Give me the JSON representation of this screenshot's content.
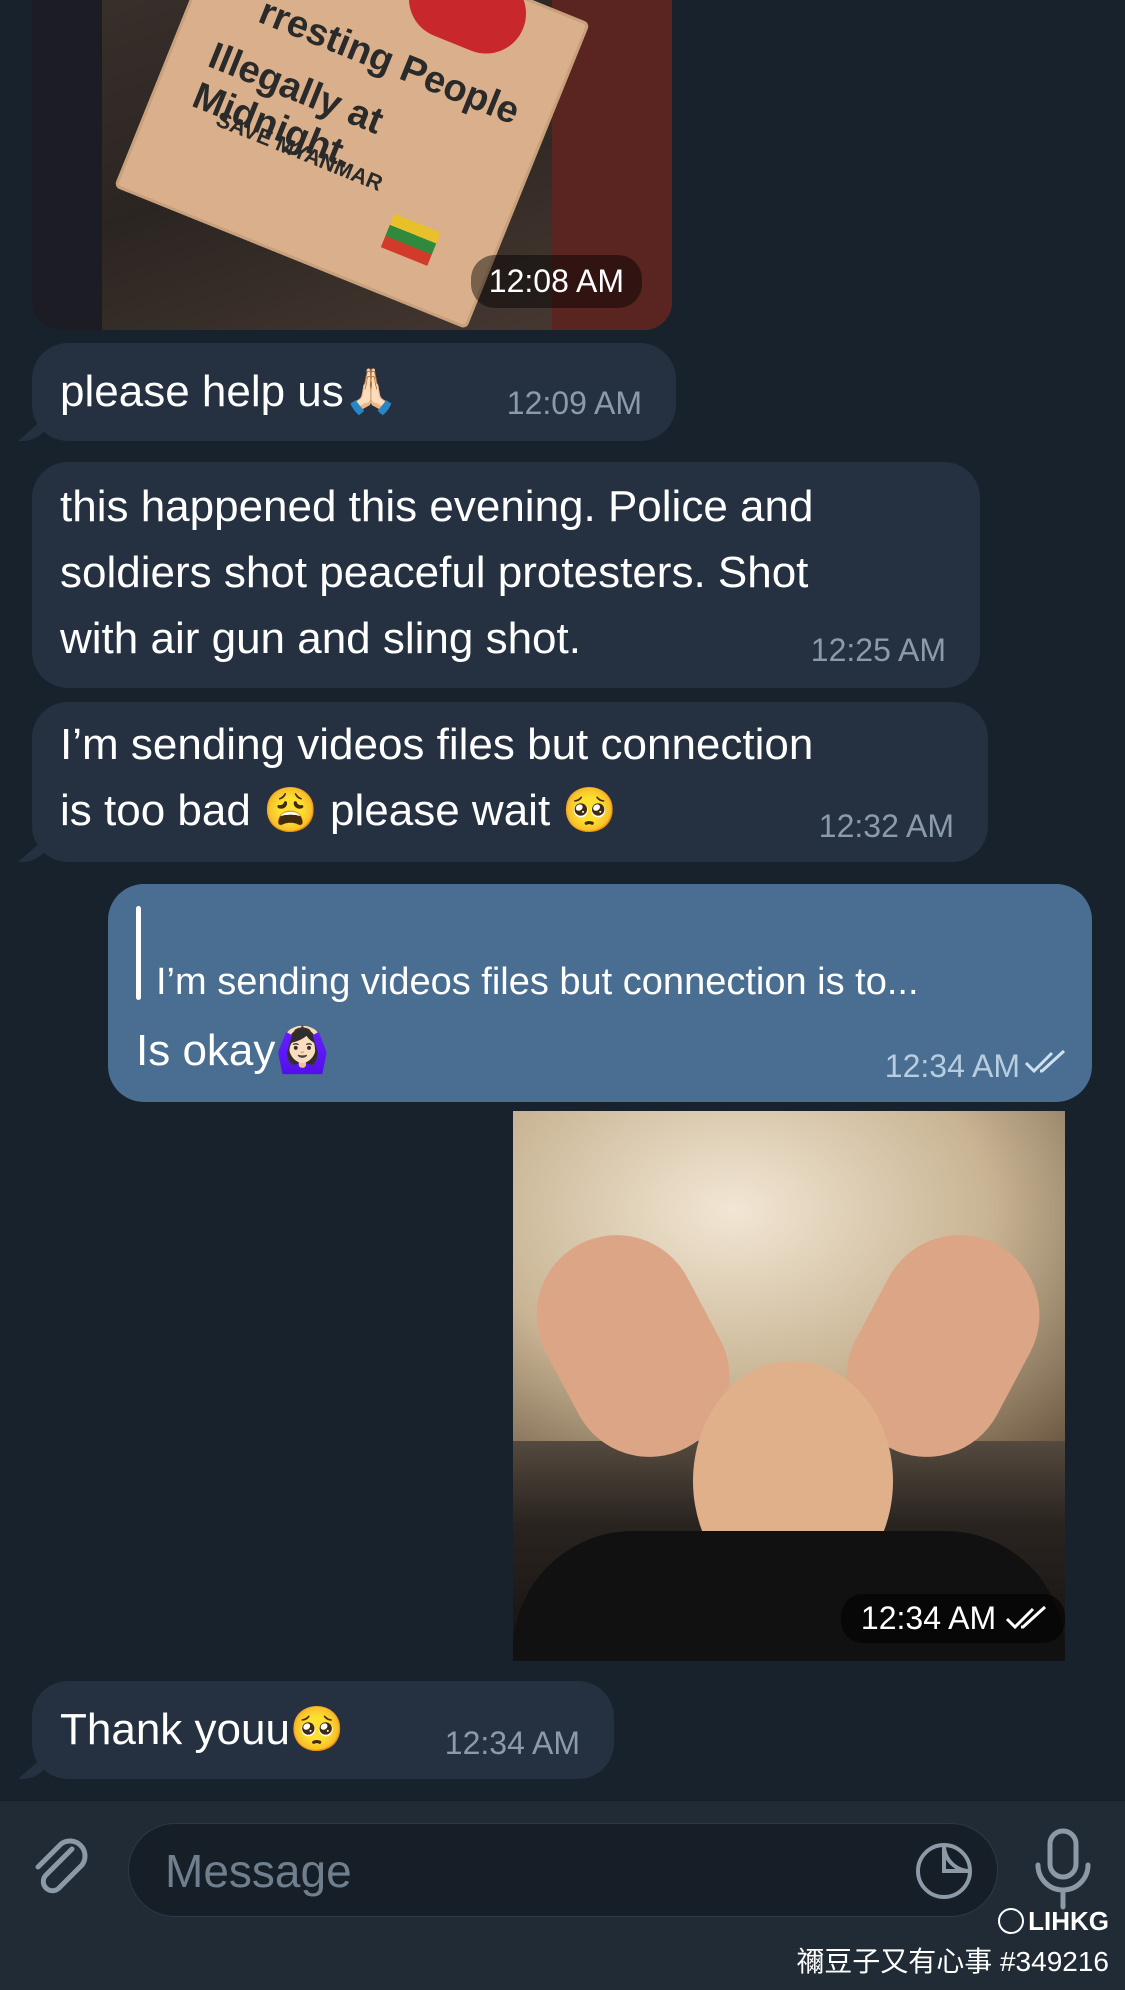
{
  "messages": {
    "photo1": {
      "time": "12:08 AM",
      "sign_line1": "rresting People",
      "sign_line2": "Illegally at Midnight.",
      "sign_line3": "SAVE MYANMAR"
    },
    "m1": {
      "text": "please help us🙏🏻",
      "time": "12:09 AM"
    },
    "m2": {
      "text": "this happened this evening. Police and\nsoldiers shot peaceful protesters. Shot\nwith air gun and  sling shot.",
      "time": "12:25 AM"
    },
    "m3": {
      "text": "I’m sending videos files but connection\nis too bad 😩 please wait 🥺",
      "time": "12:32 AM"
    },
    "m4": {
      "reply_preview": "I’m sending videos files but connection is to...",
      "text": "Is okay🙆🏻‍♀️",
      "time": "12:34 AM",
      "status_icon": "double-check-icon"
    },
    "video": {
      "time": "12:34 AM",
      "status_icon": "double-check-icon"
    },
    "m5": {
      "text": "Thank youu🥺",
      "time": "12:34 AM"
    }
  },
  "input": {
    "placeholder": "Message",
    "attach_icon": "paperclip-icon",
    "sticker_icon": "sticker-icon",
    "mic_icon": "microphone-icon"
  },
  "watermark": {
    "brand": "LIHKG",
    "caption": "禰豆子又有心事 #349216"
  },
  "colors": {
    "background": "#18222d",
    "incoming": "#253140",
    "outgoing": "#4a6e92",
    "timestamp": "#8a9bac"
  }
}
